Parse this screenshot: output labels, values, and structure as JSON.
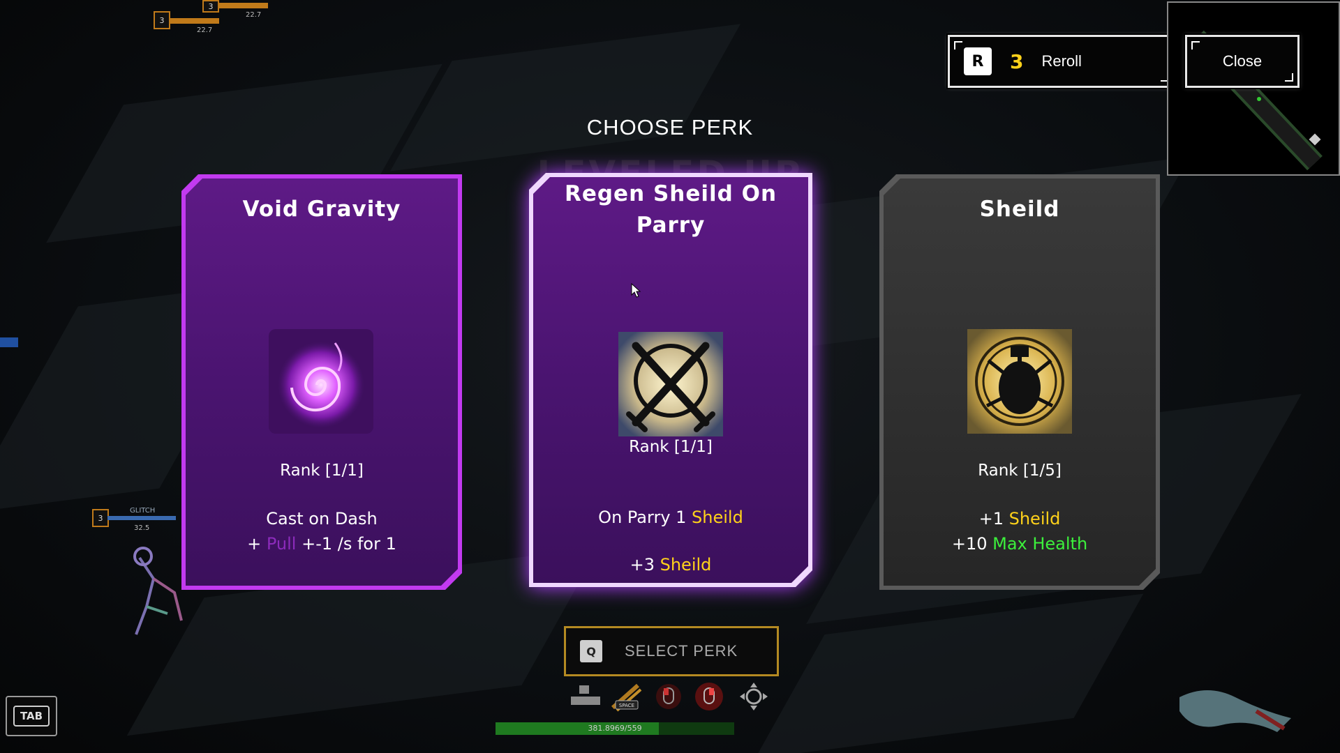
{
  "hud": {
    "player1": {
      "level": "3",
      "value": "22.7"
    },
    "player2": {
      "level": "3",
      "value": "22.7"
    },
    "glitch": {
      "level": "3",
      "name": "GLITCH",
      "value": "32.5"
    }
  },
  "top_buttons": {
    "reroll": {
      "key": "R",
      "count": "3",
      "label": "Reroll"
    },
    "close": {
      "label": "Close"
    }
  },
  "title": "CHOOSE PERK",
  "ghost_title": "LEVELED UP",
  "cards": [
    {
      "title": "Void Gravity",
      "icon": "void-swirl-icon",
      "rank": "Rank [1/1]",
      "desc_line1": "Cast on Dash",
      "desc_line2_a": "+ ",
      "desc_line2_highlight": "Pull",
      "desc_line2_b": " +-1 /s for 1",
      "color": "#b829e6"
    },
    {
      "title": "Regen Sheild On Parry",
      "icon": "crossed-swords-icon",
      "rank": "Rank [1/1]",
      "desc_line1_a": "On Parry 1 ",
      "desc_line1_highlight": "Sheild",
      "desc_line2_a": "+3 ",
      "desc_line2_highlight": "Sheild",
      "color": "#d9a8ff"
    },
    {
      "title": "Sheild",
      "icon": "shield-beetle-icon",
      "rank": "Rank [1/5]",
      "desc_line1_a": "+1 ",
      "desc_line1_highlight": "Sheild",
      "desc_line2_a": "+10 ",
      "desc_line2_highlight": "Max Health",
      "color": "#5a5a5a"
    }
  ],
  "select": {
    "key": "Q",
    "label": "SELECT PERK"
  },
  "skills": [
    "blocks-icon",
    "dash-space-icon",
    "mouse-left-icon",
    "mouse-right-icon",
    "move-icon"
  ],
  "skill_space_label": "SPACE",
  "xp": {
    "text": "381.8969/559",
    "fraction": 0.683
  },
  "tab_key": "TAB",
  "colors": {
    "accent_yellow": "#ffd21a",
    "accent_green": "#3cf03c",
    "pull_purple": "#8c2bbb",
    "select_border": "#b48a22"
  }
}
